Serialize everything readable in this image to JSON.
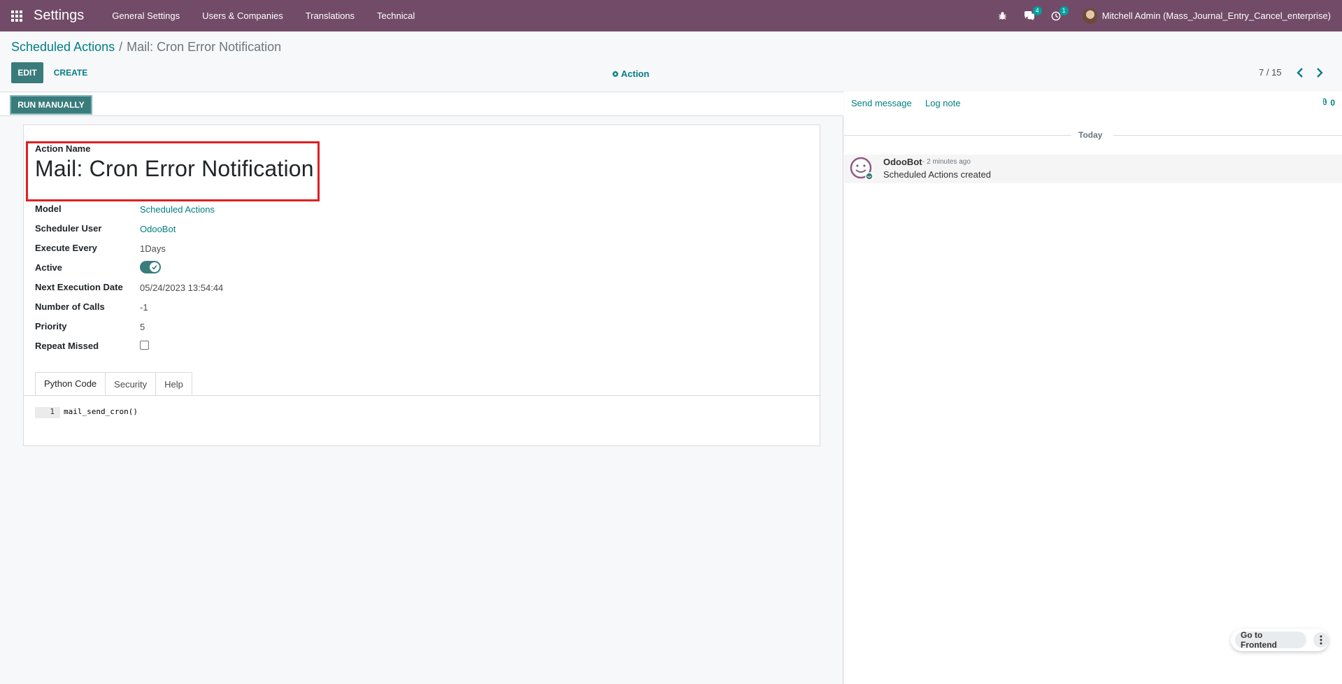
{
  "navbar": {
    "app_title": "Settings",
    "menu": [
      "General Settings",
      "Users & Companies",
      "Translations",
      "Technical"
    ],
    "messages_badge": "4",
    "activities_badge": "1",
    "user_name": "Mitchell Admin (Mass_Journal_Entry_Cancel_enterprise)"
  },
  "breadcrumb": {
    "parent": "Scheduled Actions",
    "separator": "/",
    "current": "Mail: Cron Error Notification"
  },
  "toolbar": {
    "edit_label": "EDIT",
    "create_label": "CREATE",
    "action_label": "Action",
    "pager": "7 / 15"
  },
  "statusbar": {
    "run_label": "RUN MANUALLY"
  },
  "form": {
    "action_name_label": "Action Name",
    "action_name": "Mail: Cron Error Notification",
    "fields": {
      "model_label": "Model",
      "model_value": "Scheduled Actions",
      "user_label": "Scheduler User",
      "user_value": "OdooBot",
      "execute_label": "Execute Every",
      "execute_value": "1Days",
      "active_label": "Active",
      "next_label": "Next Execution Date",
      "next_value": "05/24/2023 13:54:44",
      "calls_label": "Number of Calls",
      "calls_value": "-1",
      "priority_label": "Priority",
      "priority_value": "5",
      "repeat_label": "Repeat Missed"
    },
    "active_checked": true,
    "repeat_missed_checked": false,
    "tabs": [
      "Python Code",
      "Security",
      "Help"
    ],
    "code": {
      "line_number": "1",
      "line": "mail_send_cron()"
    }
  },
  "chatter": {
    "send_message": "Send message",
    "log_note": "Log note",
    "attachments_count": "0",
    "date_separator": "Today",
    "message": {
      "author": "OdooBot",
      "date": "- 2 minutes ago",
      "body": "Scheduled Actions created"
    }
  },
  "frontend": {
    "label": "Go to Frontend"
  },
  "colors": {
    "navbar": "#714b67",
    "primary": "#3a7b7c",
    "link": "#017e84",
    "highlight": "#e02020"
  }
}
